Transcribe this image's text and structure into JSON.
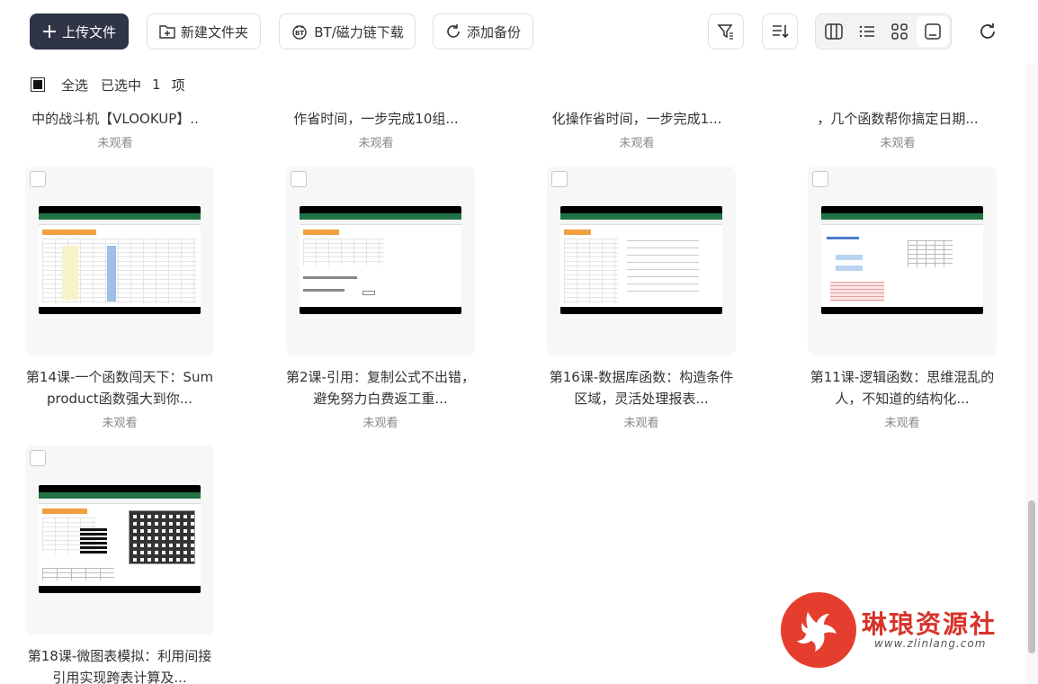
{
  "toolbar": {
    "upload_label": "上传文件",
    "new_folder_label": "新建文件夹",
    "bt_label": "BT/磁力链下载",
    "backup_label": "添加备份"
  },
  "selection": {
    "select_all": "全选",
    "selected_prefix": "已选中",
    "count": "1",
    "unit": "项"
  },
  "top_row": [
    {
      "title": "中的战斗机【VLOOKUP】..",
      "status": "未观看"
    },
    {
      "title": "作省时间，一步完成10组...",
      "status": "未观看"
    },
    {
      "title": "化操作省时间，一步完成1...",
      "status": "未观看"
    },
    {
      "title": "，几个函数帮你搞定日期...",
      "status": "未观看"
    }
  ],
  "cards": [
    {
      "title": "第14课-一个函数闯天下：Sumproduct函数强大到你...",
      "status": "未观看"
    },
    {
      "title": "第2课-引用：复制公式不出错，避免努力白费返工重...",
      "status": "未观看"
    },
    {
      "title": "第16课-数据库函数：构造条件区域，灵活处理报表...",
      "status": "未观看"
    },
    {
      "title": "第11课-逻辑函数：思维混乱的人，不知道的结构化...",
      "status": "未观看"
    },
    {
      "title": "第18课-微图表模拟：利用间接引用实现跨表计算及...",
      "status": ""
    }
  ],
  "watermark": {
    "name": "琳琅资源社",
    "url": "www.zlinlang.com"
  },
  "colors": {
    "primary": "#2f3447",
    "excel_green": "#217346",
    "watermark_red": "#e53e2e"
  }
}
